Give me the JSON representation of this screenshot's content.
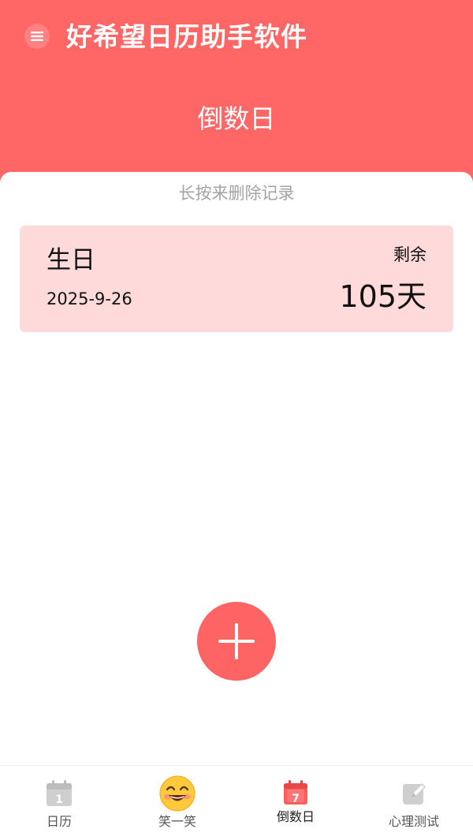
{
  "header": {
    "app_title": "好希望日历助手软件",
    "page_title": "倒数日",
    "menu_icon": "menu-icon"
  },
  "main": {
    "hint": "长按来删除记录",
    "records": [
      {
        "name": "生日",
        "date": "2025-9-26",
        "remain_label": "剩余",
        "remain_value": "105天"
      }
    ],
    "add_icon": "plus-icon"
  },
  "tabbar": {
    "tabs": [
      {
        "label": "日历",
        "icon": "calendar-icon",
        "icon_text": "1",
        "active": false
      },
      {
        "label": "笑一笑",
        "icon": "smile-emoji-icon",
        "active": false
      },
      {
        "label": "倒数日",
        "icon": "countdown-calendar-icon",
        "icon_text": "7",
        "active": true
      },
      {
        "label": "心理测试",
        "icon": "edit-note-icon",
        "active": false
      }
    ]
  },
  "colors": {
    "accent": "#ff6666",
    "card_bg": "#ffdada",
    "hint_text": "#a3a3a3",
    "tab_inactive": "#c8c8c8"
  }
}
